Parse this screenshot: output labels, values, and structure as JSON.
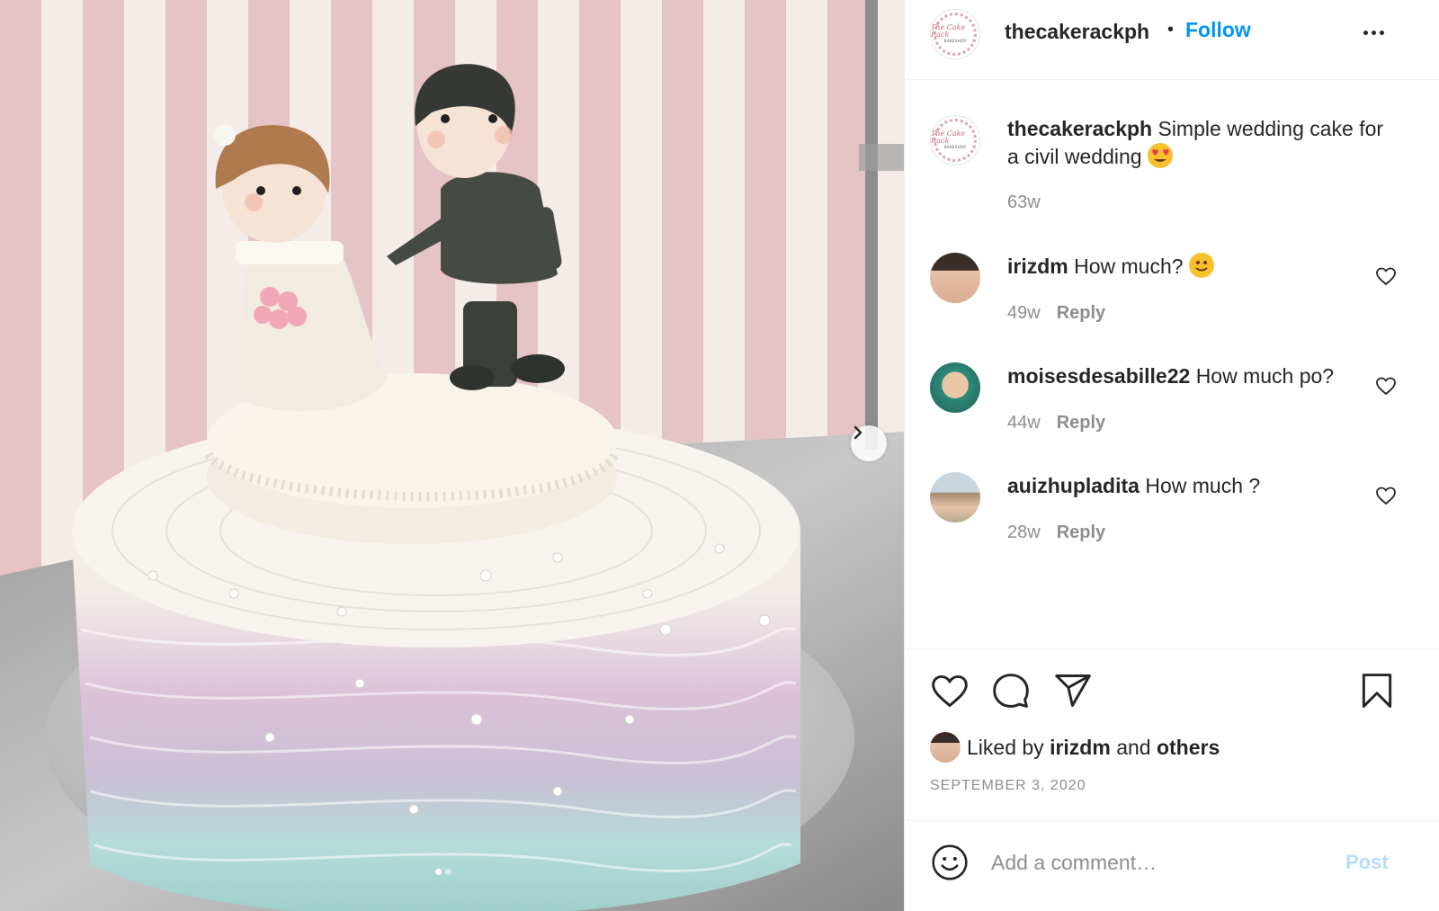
{
  "post": {
    "username": "thecakerackph",
    "follow_label": "Follow",
    "logo_text": "The Cake Rack",
    "logo_subtext": "BAKESHOP"
  },
  "caption": {
    "username": "thecakerackph",
    "text": "Simple wedding cake for a civil wedding",
    "emoji": "heart-eyes-emoji",
    "time": "63w"
  },
  "comments": [
    {
      "username": "irizdm",
      "text": "How much?",
      "emoji": "smiling-emoji",
      "time": "49w",
      "reply_label": "Reply"
    },
    {
      "username": "moisesdesabille22",
      "text": "How much po?",
      "time": "44w",
      "reply_label": "Reply"
    },
    {
      "username": "auizhupladita",
      "text": "How much ?",
      "time": "28w",
      "reply_label": "Reply"
    }
  ],
  "likes": {
    "prefix": "Liked by",
    "user": "irizdm",
    "joiner": "and",
    "others": "others"
  },
  "date": "SEPTEMBER 3, 2020",
  "comment_box": {
    "placeholder": "Add a comment…",
    "post_label": "Post"
  },
  "carousel": {
    "slides": 2,
    "current": 1
  },
  "colors": {
    "follow": "#0095f6",
    "post_disabled": "#b2dffc",
    "muted": "#8e8e8e",
    "text": "#262626"
  }
}
